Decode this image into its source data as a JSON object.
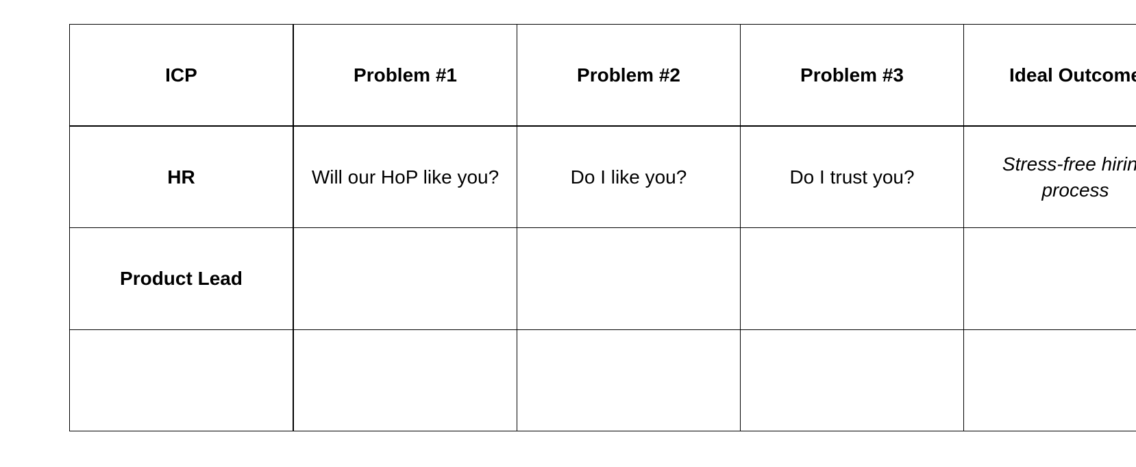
{
  "table": {
    "headers": [
      "ICP",
      "Problem #1",
      "Problem #2",
      "Problem #3",
      "Ideal Outcome"
    ],
    "rows": [
      {
        "label": "HR",
        "cells": [
          "Will our HoP like you?",
          "Do I like you?",
          "Do I trust you?",
          "Stress-free hiring process"
        ]
      },
      {
        "label": "Product Lead",
        "cells": [
          "",
          "",
          "",
          ""
        ]
      },
      {
        "label": "",
        "cells": [
          "",
          "",
          "",
          ""
        ]
      }
    ]
  }
}
